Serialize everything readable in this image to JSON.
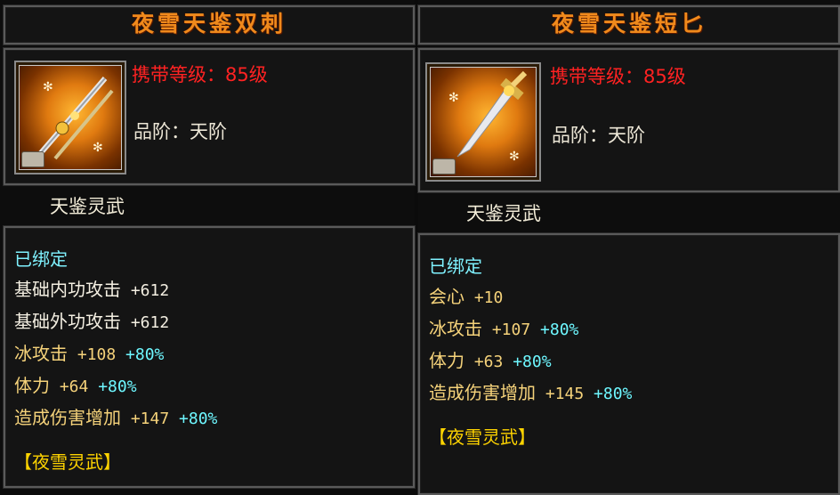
{
  "left": {
    "title": "夜雪天鉴双刺",
    "level_line": "携带等级：85级",
    "grade_line": "品阶：天阶",
    "subtitle": "天鉴灵武",
    "bound": "已绑定",
    "attrs": [
      {
        "name": "基础内功攻击",
        "value": "+612",
        "pct": "",
        "color": "white"
      },
      {
        "name": "基础外功攻击",
        "value": "+612",
        "pct": "",
        "color": "white"
      },
      {
        "name": "冰攻击",
        "value": "+108",
        "pct": "+80%",
        "color": "yellow"
      },
      {
        "name": "体力",
        "value": "+64",
        "pct": "+80%",
        "color": "yellow"
      },
      {
        "name": "造成伤害增加",
        "value": "+147",
        "pct": "+80%",
        "color": "yellow"
      }
    ],
    "set_title": "【夜雪灵武】"
  },
  "right": {
    "title": "夜雪天鉴短匕",
    "level_line": "携带等级：85级",
    "grade_line": "品阶：天阶",
    "subtitle": "天鉴灵武",
    "bound": "已绑定",
    "attrs": [
      {
        "name": "会心",
        "value": "+10",
        "pct": "",
        "color": "yellow"
      },
      {
        "name": "冰攻击",
        "value": "+107",
        "pct": "+80%",
        "color": "yellow"
      },
      {
        "name": "体力",
        "value": "+63",
        "pct": "+80%",
        "color": "yellow"
      },
      {
        "name": "造成伤害增加",
        "value": "+145",
        "pct": "+80%",
        "color": "yellow"
      }
    ],
    "set_title": "【夜雪灵武】"
  }
}
